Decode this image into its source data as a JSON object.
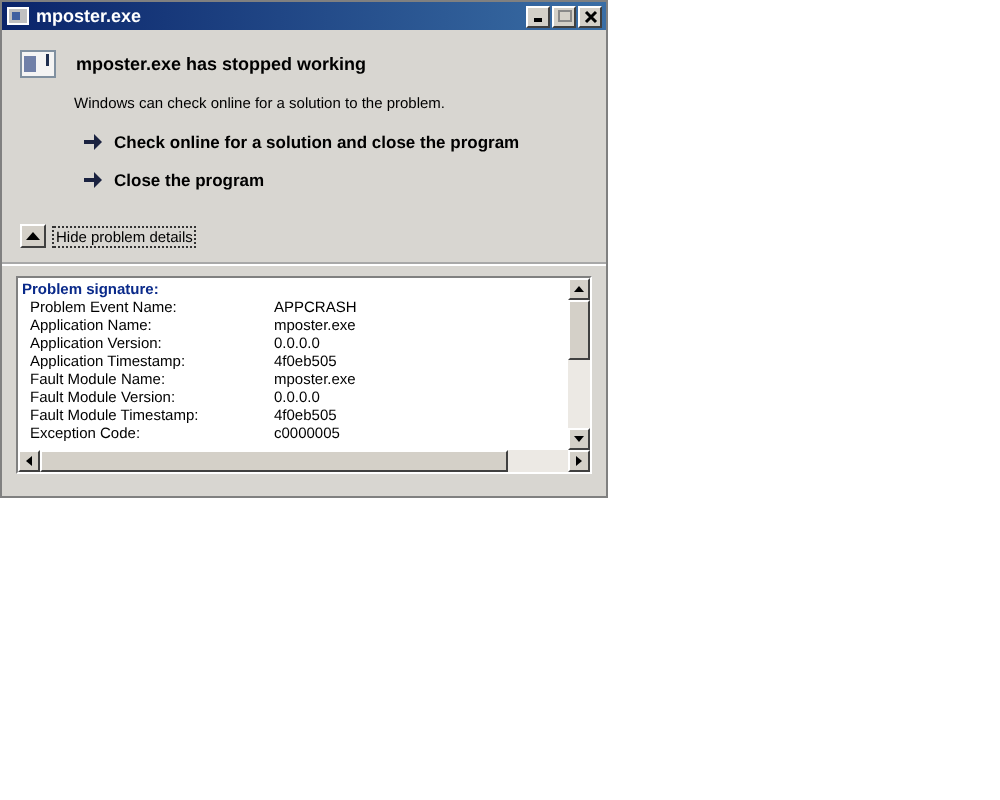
{
  "window": {
    "title": "mposter.exe"
  },
  "heading": "mposter.exe has stopped working",
  "message": "Windows can check online for a solution to the problem.",
  "options": [
    {
      "label": "Check online for a solution and close the program"
    },
    {
      "label": "Close the program"
    }
  ],
  "details_toggle": {
    "label": "Hide problem details",
    "expanded": true
  },
  "details": {
    "title": "Problem signature:",
    "rows": [
      {
        "name": "Problem Event Name:",
        "value": "APPCRASH"
      },
      {
        "name": "Application Name:",
        "value": "mposter.exe"
      },
      {
        "name": "Application Version:",
        "value": "0.0.0.0"
      },
      {
        "name": "Application Timestamp:",
        "value": "4f0eb505"
      },
      {
        "name": "Fault Module Name:",
        "value": "mposter.exe"
      },
      {
        "name": "Fault Module Version:",
        "value": "0.0.0.0"
      },
      {
        "name": "Fault Module Timestamp:",
        "value": "4f0eb505"
      },
      {
        "name": "Exception Code:",
        "value": "c0000005"
      }
    ]
  }
}
